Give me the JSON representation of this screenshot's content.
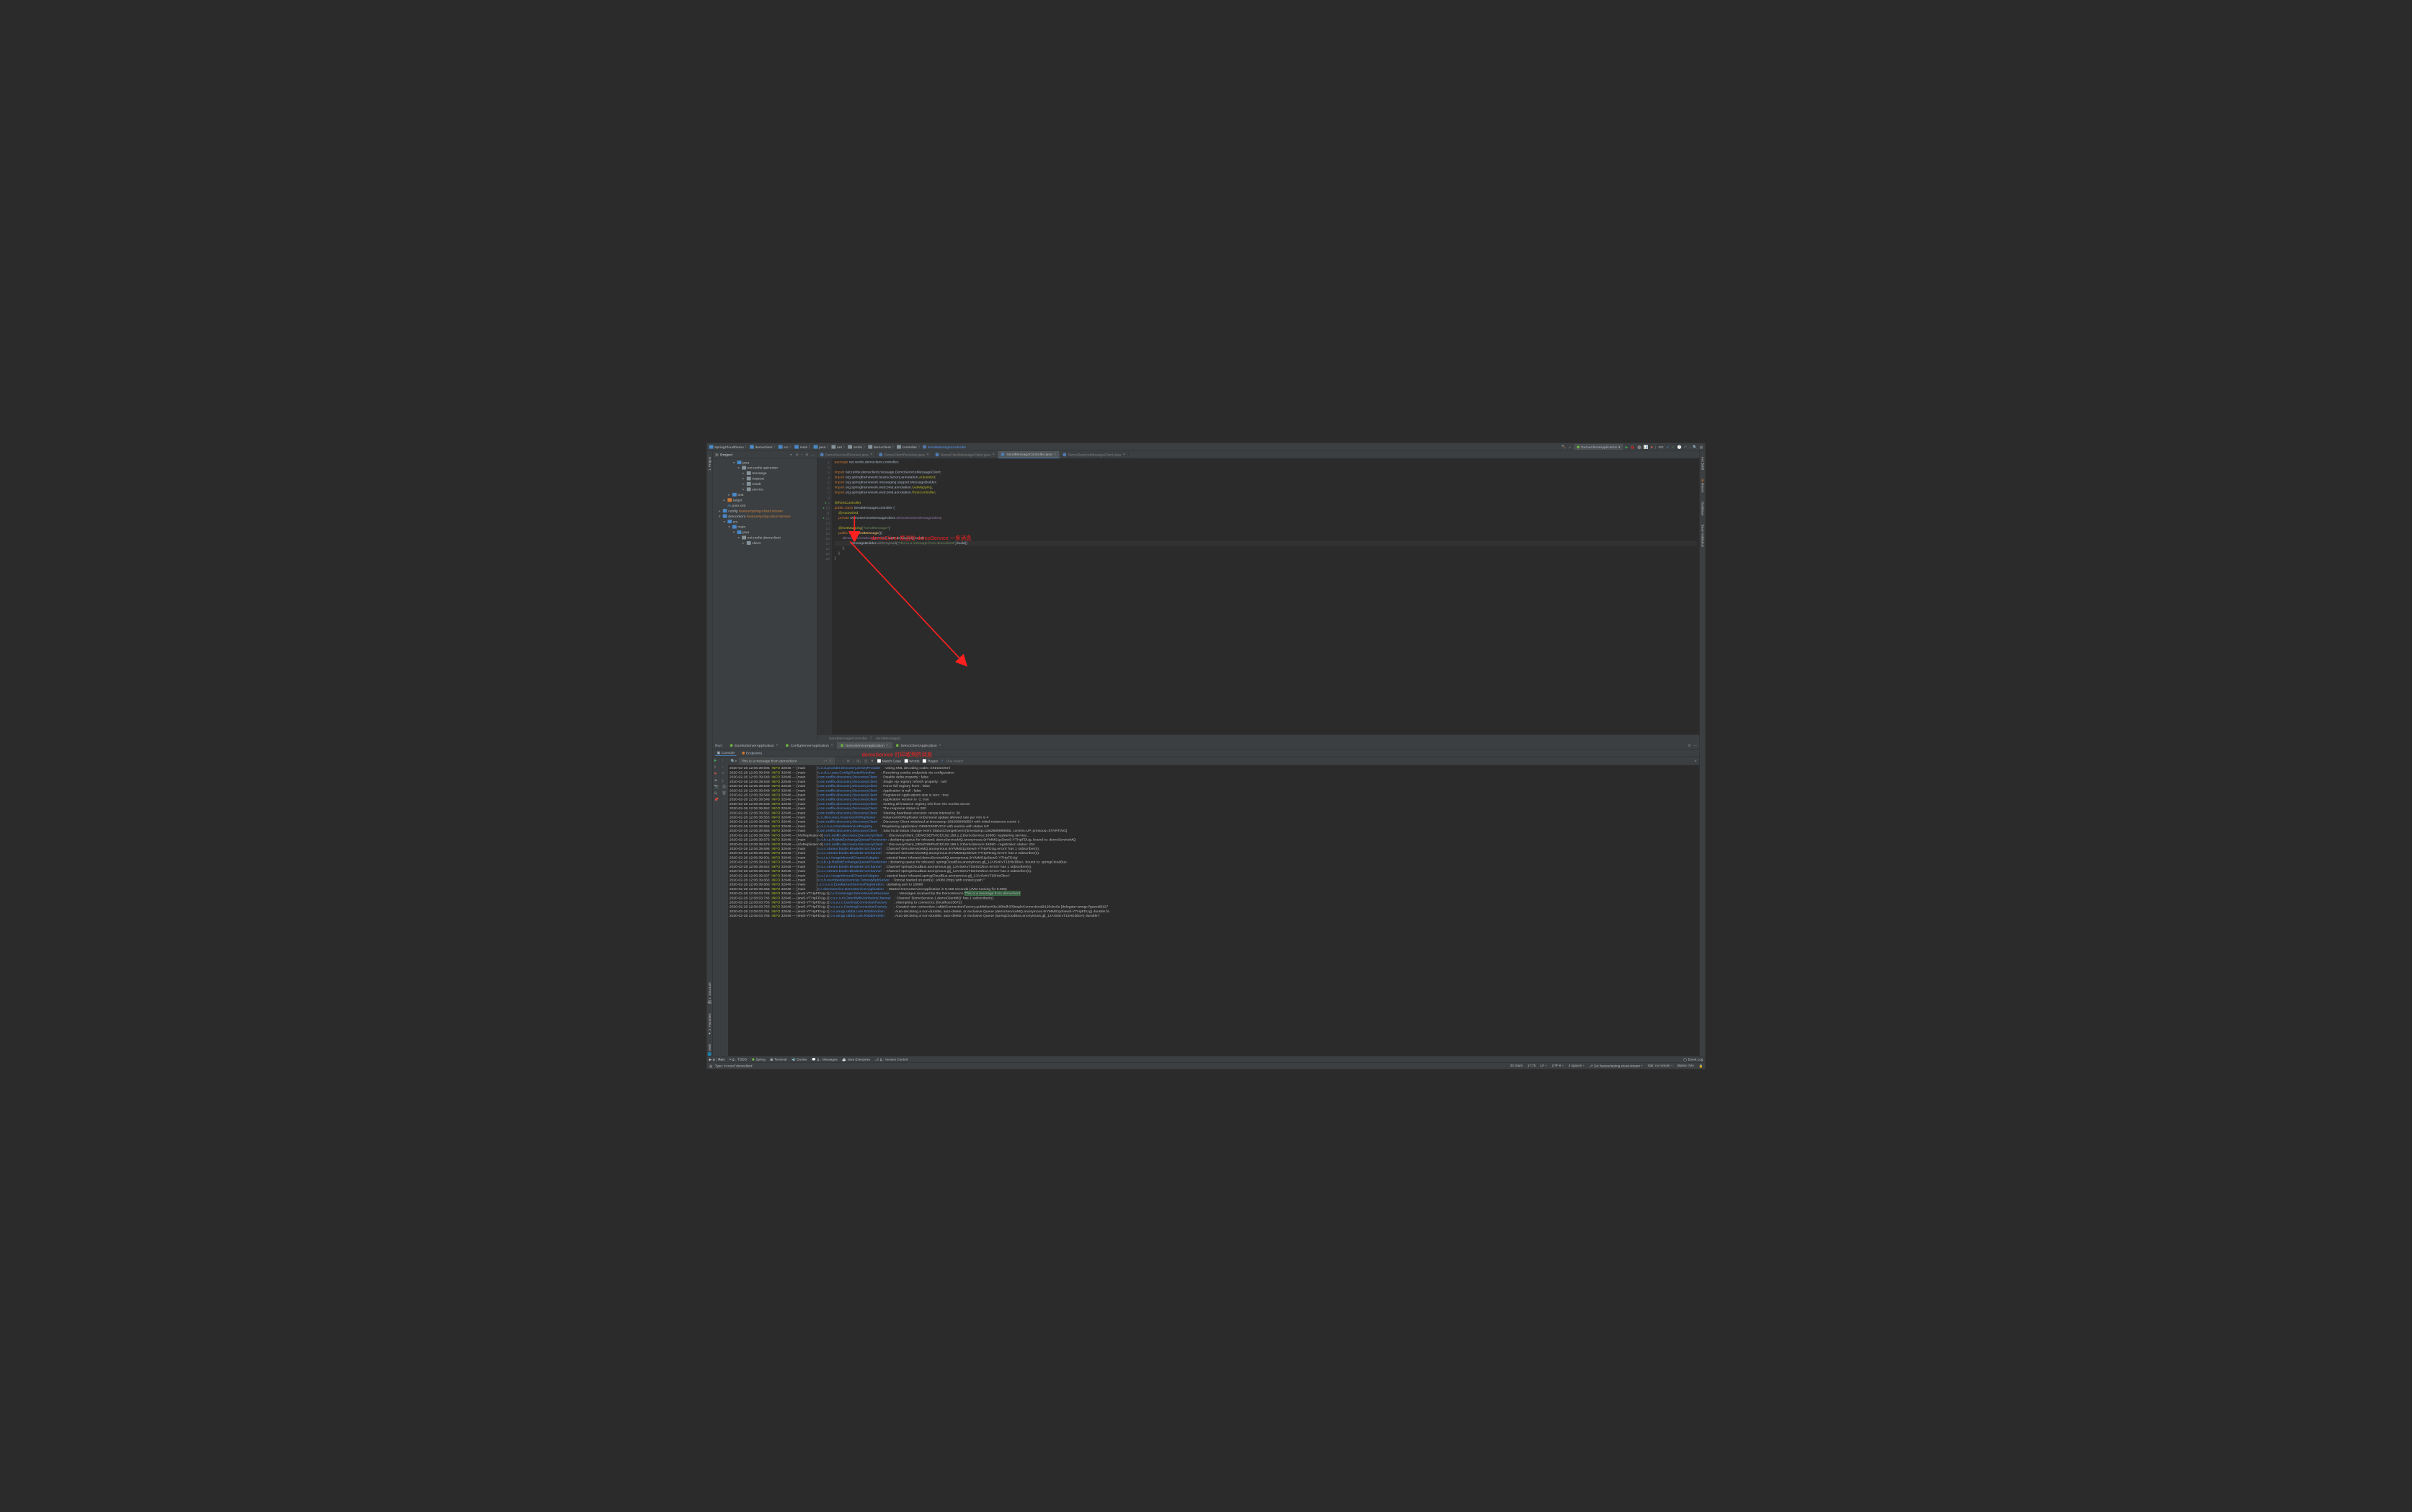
{
  "breadcrumb": {
    "items": [
      "SpringCloudDemo",
      "democlient",
      "src",
      "main",
      "java",
      "net",
      "renfei",
      "democlient",
      "controller"
    ],
    "class": "SendMessageController"
  },
  "top_right": {
    "run_config": "DemoClientApplication",
    "git": "Git:"
  },
  "left_gutter": {
    "project": "1: Project"
  },
  "right_gutter": {
    "items": [
      "Ant Build",
      "Maven",
      "Database",
      "Bean Validation"
    ]
  },
  "project_panel": {
    "title": "Project",
    "tree": [
      {
        "indent": 3,
        "arrow": "▾",
        "icon": "folder-blue",
        "label": "java"
      },
      {
        "indent": 4,
        "arrow": "▾",
        "icon": "folder",
        "label": "net.renfei.apicenter"
      },
      {
        "indent": 5,
        "arrow": "▸",
        "icon": "folder",
        "label": "message"
      },
      {
        "indent": 5,
        "arrow": "▸",
        "icon": "folder",
        "label": "request"
      },
      {
        "indent": 5,
        "arrow": "▸",
        "icon": "folder",
        "label": "result"
      },
      {
        "indent": 5,
        "arrow": "▸",
        "icon": "folder",
        "label": "service"
      },
      {
        "indent": 2,
        "arrow": "▸",
        "icon": "folder-blue",
        "label": "test"
      },
      {
        "indent": 1,
        "arrow": "▸",
        "icon": "folder-orange",
        "label": "target"
      },
      {
        "indent": 1,
        "arrow": "",
        "icon": "pom",
        "label": "pom.xml"
      },
      {
        "indent": 0,
        "arrow": "▸",
        "icon": "folder-blue",
        "label": "config",
        "branch": "feature/spring-cloud-stream"
      },
      {
        "indent": 0,
        "arrow": "▾",
        "icon": "folder-blue",
        "label": "democlient",
        "branch": "feature/spring-cloud-stream"
      },
      {
        "indent": 1,
        "arrow": "▾",
        "icon": "folder-blue",
        "label": "src"
      },
      {
        "indent": 2,
        "arrow": "▾",
        "icon": "folder-blue",
        "label": "main"
      },
      {
        "indent": 3,
        "arrow": "▾",
        "icon": "folder-blue",
        "label": "java"
      },
      {
        "indent": 4,
        "arrow": "▾",
        "icon": "folder",
        "label": "net.renfei.democlient"
      },
      {
        "indent": 5,
        "arrow": "▸",
        "icon": "folder",
        "label": "client"
      }
    ]
  },
  "editor_tabs": [
    {
      "label": "DemoServiceReceiver.java",
      "active": false
    },
    {
      "label": "DemoClientReceiver.java",
      "active": false
    },
    {
      "label": "DemoClientMessageClient.java",
      "active": false
    },
    {
      "label": "SendMessageController.java",
      "active": true
    },
    {
      "label": "DemoServiceMessageClient.java",
      "active": false
    }
  ],
  "code": {
    "lines": [
      {
        "n": 1,
        "html": "<span class='kw'>package</span> net.renfei.democlient.controller;"
      },
      {
        "n": 2,
        "html": ""
      },
      {
        "n": 3,
        "html": "<span class='kw'>import</span> net.renfei.democlient.message.DemoServiceMessageClient;"
      },
      {
        "n": 4,
        "html": "<span class='kw'>import</span> org.springframework.beans.factory.annotation.<span class='ann'>Autowired</span>;"
      },
      {
        "n": 5,
        "html": "<span class='kw'>import</span> org.springframework.messaging.support.MessageBuilder;"
      },
      {
        "n": 6,
        "html": "<span class='kw'>import</span> org.springframework.web.bind.annotation.<span class='ann'>GetMapping</span>;"
      },
      {
        "n": 7,
        "html": "<span class='kw'>import</span> org.springframework.web.bind.annotation.<span class='ann'>RestController</span>;"
      },
      {
        "n": 8,
        "html": ""
      },
      {
        "n": 9,
        "html": "<span class='ann'>@RestController</span>",
        "run": true
      },
      {
        "n": 10,
        "html": "<span class='kw'>public class</span> SendMessageController {",
        "run": true
      },
      {
        "n": 11,
        "html": "    <span class='ann'>@Autowired</span>"
      },
      {
        "n": 12,
        "html": "    <span class='kw'>private</span> DemoServiceMessageClient <span class='fld'>demoServiceMessageClient</span>;",
        "run": true
      },
      {
        "n": 13,
        "html": ""
      },
      {
        "n": 14,
        "html": "    <span class='ann'>@GetMapping</span>(<span class='str'>\"/sendMessage\"</span>)"
      },
      {
        "n": 15,
        "html": "    <span class='kw'>public void</span> <span class='mth'>sendMessage</span>(){"
      },
      {
        "n": 16,
        "html": "        <span class='fld'>demoServiceMessageClient</span>.outPutChannel().send("
      },
      {
        "n": 17,
        "html": "                MessageBuilder.<span class='com'>withPayload</span>(<span class='str'>\"This is a message from democlient\"</span>).build()",
        "caret": true
      },
      {
        "n": 18,
        "html": "        );"
      },
      {
        "n": 19,
        "html": "    }"
      },
      {
        "n": 20,
        "html": "}"
      }
    ]
  },
  "editor_breadcrumb": {
    "items": [
      "SendMessageController",
      "sendMessage()"
    ]
  },
  "annotations": {
    "line1": "demoClient 发送给 demoService 一条消息",
    "line2": "demoService 打印收到的消息"
  },
  "run_panel": {
    "title": "Run:",
    "tabs": [
      {
        "label": "EurekaServerApplication"
      },
      {
        "label": "ConfigServerApplication"
      },
      {
        "label": "DemoServiceApplication",
        "active": true
      },
      {
        "label": "DemoClientApplication"
      }
    ],
    "sub_tabs": [
      {
        "label": "Console",
        "icon": "console",
        "active": true
      },
      {
        "label": "Endpoints",
        "icon": "endpoints"
      }
    ]
  },
  "search": {
    "value": "This is a message from democlient",
    "match_case": "Match Case",
    "words": "Words",
    "regex": "Regex",
    "question": "?",
    "count": "One match"
  },
  "console_lines": [
    {
      "ts": "2020-02-26 12:06:39.505",
      "lv": "INFO",
      "pid": "32946",
      "th": "main",
      "cls": "c.n.d.provider.DiscoveryJerseyProvider",
      "msg": "Using XML decoding codec XStreamXml"
    },
    {
      "ts": "2020-02-26 12:06:39.548",
      "lv": "INFO",
      "pid": "32946",
      "th": "main",
      "cls": "c.n.d.s.r.aws.ConfigClusterResolver",
      "msg": "Resolving eureka endpoints via configuration"
    },
    {
      "ts": "2020-02-26 12:06:39.549",
      "lv": "INFO",
      "pid": "32946",
      "th": "main",
      "cls": "com.netflix.discovery.DiscoveryClient",
      "msg": "Disable delta property : false"
    },
    {
      "ts": "2020-02-26 12:06:39.549",
      "lv": "INFO",
      "pid": "32946",
      "th": "main",
      "cls": "com.netflix.discovery.DiscoveryClient",
      "msg": "Single vip registry refresh property : null"
    },
    {
      "ts": "2020-02-26 12:06:39.549",
      "lv": "INFO",
      "pid": "32946",
      "th": "main",
      "cls": "com.netflix.discovery.DiscoveryClient",
      "msg": "Force full registry fetch : false"
    },
    {
      "ts": "2020-02-26 12:06:39.549",
      "lv": "INFO",
      "pid": "32946",
      "th": "main",
      "cls": "com.netflix.discovery.DiscoveryClient",
      "msg": "Application is null : false"
    },
    {
      "ts": "2020-02-26 12:06:39.549",
      "lv": "INFO",
      "pid": "32946",
      "th": "main",
      "cls": "com.netflix.discovery.DiscoveryClient",
      "msg": "Registered Applications size is zero : true"
    },
    {
      "ts": "2020-02-26 12:06:39.549",
      "lv": "INFO",
      "pid": "32946",
      "th": "main",
      "cls": "com.netflix.discovery.DiscoveryClient",
      "msg": "Application version is -1: true"
    },
    {
      "ts": "2020-02-26 12:06:39.549",
      "lv": "INFO",
      "pid": "32946",
      "th": "main",
      "cls": "com.netflix.discovery.DiscoveryClient",
      "msg": "Getting all instance registry info from the eureka server"
    },
    {
      "ts": "2020-02-26 12:06:39.552",
      "lv": "INFO",
      "pid": "32946",
      "th": "main",
      "cls": "com.netflix.discovery.DiscoveryClient",
      "msg": "The response status is 200"
    },
    {
      "ts": "2020-02-26 12:06:39.552",
      "lv": "INFO",
      "pid": "32946",
      "th": "main",
      "cls": "com.netflix.discovery.DiscoveryClient",
      "msg": "Starting heartbeat executor: renew interval is: 30"
    },
    {
      "ts": "2020-02-26 12:06:39.553",
      "lv": "INFO",
      "pid": "32946",
      "th": "main",
      "cls": "c.n.discovery.InstanceInfoReplicator",
      "msg": "InstanceInfoReplicator onDemand update allowed rate per min is 4"
    },
    {
      "ts": "2020-02-26 12:06:39.554",
      "lv": "INFO",
      "pid": "32946",
      "th": "main",
      "cls": "com.netflix.discovery.DiscoveryClient",
      "msg": "Discovery Client initialized at timestamp 1582689999554 with initial instances count: 1"
    },
    {
      "ts": "2020-02-26 12:06:39.555",
      "lv": "INFO",
      "pid": "32946",
      "th": "main",
      "cls": "o.s.c.n.e.s.EurekaServiceRegistry",
      "msg": "Registering application DEMOSERVICE with eureka with status UP"
    },
    {
      "ts": "2020-02-26 12:06:39.555",
      "lv": "INFO",
      "pid": "32946",
      "th": "main",
      "cls": "com.netflix.discovery.DiscoveryClient",
      "msg": "Saw local status change event StatusChangeEvent [timestamp=1582689999555, current=UP, previous=STARTING]"
    },
    {
      "ts": "2020-02-26 12:06:39.556",
      "lv": "INFO",
      "pid": "32946",
      "th": "nfoReplicator-0",
      "cls": "com.netflix.discovery.DiscoveryClient",
      "msg": "DiscoveryClient_DEMOSERVICE/192.168.1.2:DemoService:18080: registering service..."
    },
    {
      "ts": "2020-02-26 12:06:39.573",
      "lv": "INFO",
      "pid": "32946",
      "th": "main",
      "cls": "c.s.b.r.p.RabbitExchangeQueueProvisioner",
      "msg": "declaring queue for inbound: demoServiceMQ.anonymous.9rYMMS1pSiewS-YTHpFDUg, bound to: demoServiceMQ"
    },
    {
      "ts": "2020-02-26 12:06:39.578",
      "lv": "INFO",
      "pid": "32946",
      "th": "nfoReplicator-0",
      "cls": "com.netflix.discovery.DiscoveryClient",
      "msg": "DiscoveryClient_DEMOSERVICE/192.168.1.2:DemoService:18080 - registration status: 204"
    },
    {
      "ts": "2020-02-26 12:06:39.595",
      "lv": "INFO",
      "pid": "32946",
      "th": "main",
      "cls": "o.s.c.stream.binder.BinderErrorChannel",
      "msg": "Channel 'demoServiceMQ.anonymous.9rYMMS1pSiewS-YTHpFDUg.errors' has 1 subscriber(s)."
    },
    {
      "ts": "2020-02-26 12:06:39.595",
      "lv": "INFO",
      "pid": "32946",
      "th": "main",
      "cls": "o.s.c.stream.binder.BinderErrorChannel",
      "msg": "Channel 'demoServiceMQ.anonymous.9rYMMS1pSiewS-YTHpFDUg.errors' has 2 subscriber(s)."
    },
    {
      "ts": "2020-02-26 12:06:39.601",
      "lv": "INFO",
      "pid": "32946",
      "th": "main",
      "cls": "o.s.i.a.i.AmqpInboundChannelAdapter",
      "msg": "started bean 'inbound.demoServiceMQ.anonymous.9rYMMS1pSiewS-YTHpFDUg'"
    },
    {
      "ts": "2020-02-26 12:06:39.613",
      "lv": "INFO",
      "pid": "32946",
      "th": "main",
      "cls": "c.s.b.r.p.RabbitExchangeQueueProvisioner",
      "msg": "declaring queue for inbound: springCloudBus.anonymous.glj_1JArSxKvT15HizDbxA, bound to: springCloudBus"
    },
    {
      "ts": "2020-02-26 12:06:39.622",
      "lv": "INFO",
      "pid": "32946",
      "th": "main",
      "cls": "o.s.c.stream.binder.BinderErrorChannel",
      "msg": "Channel 'springCloudBus.anonymous.glj_1JArSxKvT15HizDbxA.errors' has 1 subscriber(s)."
    },
    {
      "ts": "2020-02-26 12:06:39.622",
      "lv": "INFO",
      "pid": "32946",
      "th": "main",
      "cls": "o.s.c.stream.binder.BinderErrorChannel",
      "msg": "Channel 'springCloudBus.anonymous.glj_1JArSxKvT15HizDbxA.errors' has 2 subscriber(s)."
    },
    {
      "ts": "2020-02-26 12:06:39.627",
      "lv": "INFO",
      "pid": "32946",
      "th": "main",
      "cls": "o.s.i.a.i.AmqpInboundChannelAdapter",
      "msg": "started bean 'inbound.springCloudBus.anonymous.glj_1JArSxKvT15HizDbxA'"
    },
    {
      "ts": "2020-02-26 12:06:39.663",
      "lv": "INFO",
      "pid": "32946",
      "th": "main",
      "cls": "o.s.b.w.embedded.tomcat.TomcatWebServer",
      "msg": "Tomcat started on port(s): 18080 (http) with context path ''"
    },
    {
      "ts": "2020-02-26 12:06:39.663",
      "lv": "INFO",
      "pid": "32946",
      "th": "main",
      "cls": ".s.c.n.e.s.EurekaAutoServiceRegistration",
      "msg": "Updating port to 18080"
    },
    {
      "ts": "2020-02-26 12:06:39.668",
      "lv": "INFO",
      "pid": "32946",
      "th": "main",
      "cls": "n.r.demoservice.DemoServiceApplication",
      "msg": "Started DemoServiceApplication in 9.468 seconds (JVM running for 9.898)"
    },
    {
      "ts": "2020-02-26 12:08:03.726",
      "lv": "INFO",
      "pid": "32946",
      "th": "iewS-YTHpFDUg-1",
      "cls": "n.r.d.message.DemoServiceReceiver",
      "msg": "Messages received by the DemoService:",
      "hl": "This is a message from democlient"
    },
    {
      "ts": "2020-02-26 12:08:03.745",
      "lv": "INFO",
      "pid": "32946",
      "th": "iewS-YTHpFDUg-1",
      "cls": "o.s.c.s.m.DirectWithAttributesChannel",
      "msg": "Channel 'DemoService-1.demoClientMQ' has 1 subscriber(s)."
    },
    {
      "ts": "2020-02-26 12:08:03.753",
      "lv": "INFO",
      "pid": "32946",
      "th": "iewS-YTHpFDUg-1",
      "cls": "o.s.a.r.c.CachingConnectionFactory",
      "msg": "Attempting to connect to: [localhost:5672]"
    },
    {
      "ts": "2020-02-26 12:08:03.763",
      "lv": "INFO",
      "pid": "32946",
      "th": "iewS-YTHpFDUg-1",
      "cls": "o.s.a.r.c.CachingConnectionFactory",
      "msg": "Created new connection: rabbitConnectionFactory.publisher#3e190bdf:0/SimpleConnection@120cbc6e [delegate=amqp://guest@127"
    },
    {
      "ts": "2020-02-26 12:08:03.764",
      "lv": "INFO",
      "pid": "32946",
      "th": "iewS-YTHpFDUg-1",
      "cls": "o.s.amqp.rabbit.core.RabbitAdmin",
      "msg": "Auto-declaring a non-durable, auto-delete, or exclusive Queue (demoServiceMQ.anonymous.9rYMMS1pSiewS-YTHpFDUg) durable:fa"
    },
    {
      "ts": "2020-02-26 12:08:03.765",
      "lv": "INFO",
      "pid": "32946",
      "th": "iewS-YTHpFDUg-1",
      "cls": "o.s.amqp.rabbit.core.RabbitAdmin",
      "msg": "Auto-declaring a non-durable, auto-delete, or exclusive Queue (springCloudBus.anonymous.glj_1JArSxKvT15HizDbxA) durable:f"
    }
  ],
  "bottom_bar": {
    "items": [
      {
        "key": "4",
        "label": "Run",
        "bold": true
      },
      {
        "key": "6",
        "label": "TODO"
      },
      {
        "key": "",
        "label": "Spring"
      },
      {
        "key": "",
        "label": "Terminal"
      },
      {
        "key": "",
        "label": "Docker"
      },
      {
        "key": "0",
        "label": "Messages"
      },
      {
        "key": "",
        "label": "Java Enterprise"
      },
      {
        "key": "9",
        "label": "Version Control"
      }
    ],
    "event_log": "Event Log"
  },
  "status_bar": {
    "left": "Typo: In word 'democlient'",
    "chars": "33 chars",
    "pos": "17:78",
    "sep": "LF",
    "enc": "UTF-8",
    "indent": "4 spaces",
    "git": "Git: feature/spring-cloud-stream",
    "remote": "Stat: no remote",
    "blame": "Blame: N/A"
  }
}
